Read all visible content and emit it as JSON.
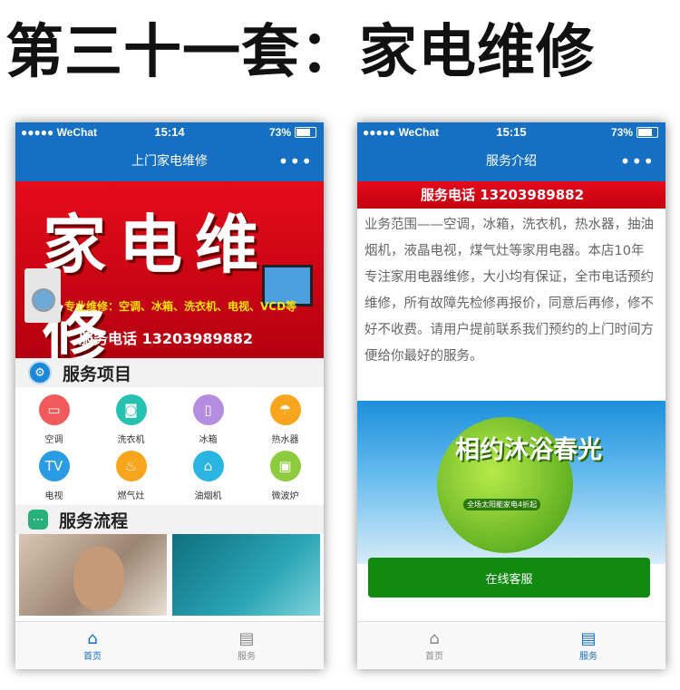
{
  "headline": "第三十一套：家电维修",
  "status": {
    "carrier": "●●●●● WeChat",
    "battery": "73%"
  },
  "screen1": {
    "time": "15:14",
    "title": "上门家电维修",
    "menu": "•••",
    "banner": {
      "big_text": "家电维修",
      "sub": "专业维修：空调、冰箱、洗衣机、电视、VCD等",
      "phone": "服务电话 13203989882"
    },
    "services_heading": "服务项目",
    "services": [
      {
        "label": "空调",
        "icon": "air-conditioner-icon",
        "color": "#f15a5a",
        "glyph": "▭"
      },
      {
        "label": "洗衣机",
        "icon": "washing-machine-icon",
        "color": "#26c1b0",
        "glyph": "◙"
      },
      {
        "label": "冰箱",
        "icon": "fridge-icon",
        "color": "#b58de0",
        "glyph": "▯"
      },
      {
        "label": "热水器",
        "icon": "water-heater-icon",
        "color": "#f7a51c",
        "glyph": "☂"
      },
      {
        "label": "电视",
        "icon": "tv-icon",
        "color": "#2a9ce6",
        "glyph": "TV"
      },
      {
        "label": "燃气灶",
        "icon": "gas-stove-icon",
        "color": "#f7a51c",
        "glyph": "♨"
      },
      {
        "label": "油烟机",
        "icon": "range-hood-icon",
        "color": "#2ab5e0",
        "glyph": "⌂"
      },
      {
        "label": "微波炉",
        "icon": "microwave-icon",
        "color": "#8fcb3f",
        "glyph": "▣"
      }
    ],
    "process_heading": "服务流程"
  },
  "screen2": {
    "time": "15:15",
    "title": "服务介绍",
    "menu": "•••",
    "strip_phone": "服务电话 13203989882",
    "description": "业务范围——空调，冰箱，洗衣机，热水器，抽油烟机，液晶电视，煤气灶等家用电器。本店10年专注家用电器维修，大小均有保证，全市电话预约维修，所有故障先检修再报价，同意后再修，修不好不收费。请用户提前联系我们预约的上门时间方便给你最好的服务。",
    "promo_title": "相约沐浴春光",
    "promo_line": "全场太阳能家电4折起",
    "cta": "在线客服"
  },
  "tabs": [
    {
      "label": "首页",
      "icon": "home-icon"
    },
    {
      "label": "服务",
      "icon": "service-icon"
    }
  ]
}
